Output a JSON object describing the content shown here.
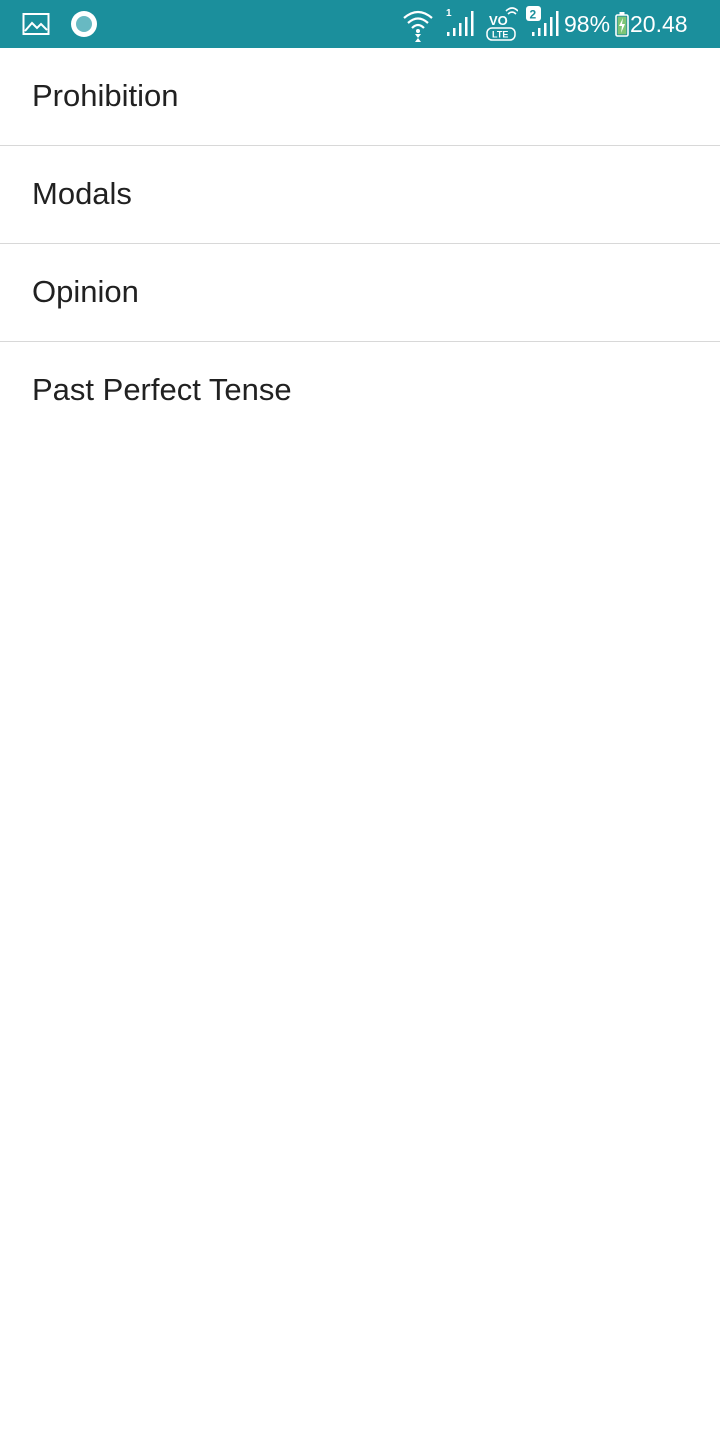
{
  "status_bar": {
    "battery_percent": "98%",
    "clock": "20.48",
    "sim1_label": "1",
    "sim2_label": "2",
    "volte_label_top": "VO",
    "volte_label_bottom": "LTE",
    "icons": [
      "gallery-icon",
      "circle-app-icon",
      "wifi-icon",
      "signal-sim1-icon",
      "volte-icon",
      "signal-sim2-icon",
      "battery-charging-icon"
    ],
    "background_color": "#1b8f9c"
  },
  "list": {
    "items": [
      {
        "label": "Prohibition"
      },
      {
        "label": "Modals"
      },
      {
        "label": "Opinion"
      },
      {
        "label": "Past Perfect Tense"
      }
    ]
  }
}
